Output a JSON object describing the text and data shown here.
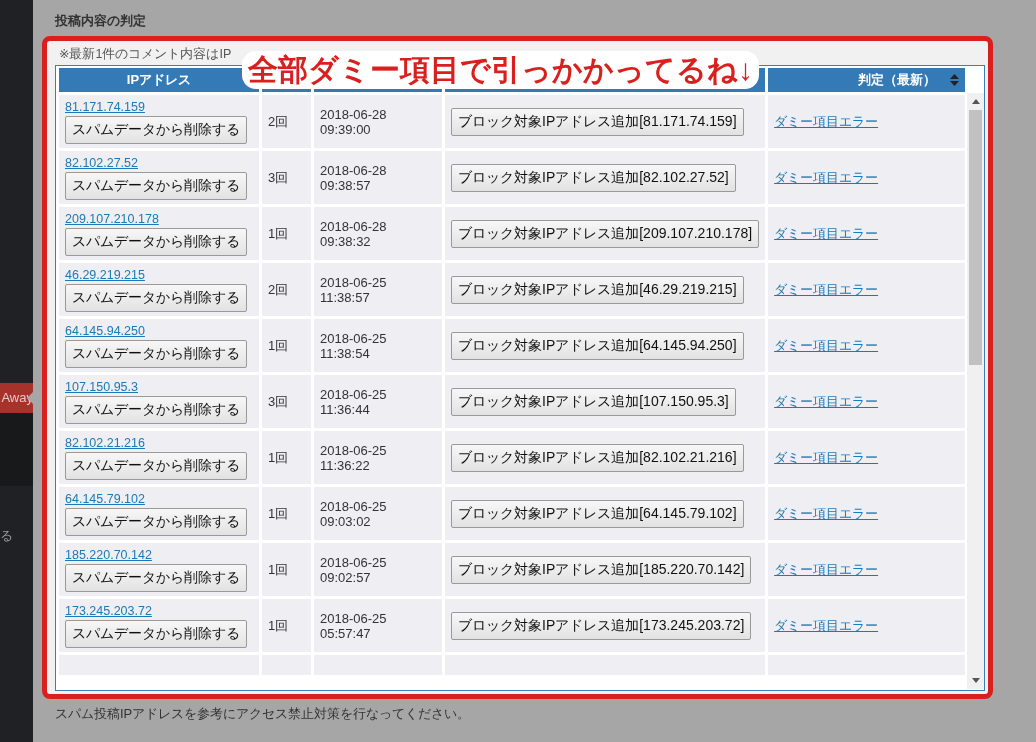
{
  "sidebar": {
    "badge": "Away",
    "fragment": "る"
  },
  "section_title": "投稿内容の判定",
  "note": "※最新1件のコメント内容はIP",
  "annotation": "全部ダミー項目で引っかかってるね↓",
  "table": {
    "columns": [
      {
        "label": "IPアドレス"
      },
      {
        "label": "判定（最新）"
      }
    ],
    "rows": [
      {
        "ip": "81.171.74.159",
        "delete": "スパムデータから削除する",
        "count": "2回",
        "date": "2018-06-28",
        "time": "09:39:00",
        "block": "ブロック対象IPアドレス追加[81.171.74.159]",
        "verdict": "ダミー項目エラー"
      },
      {
        "ip": "82.102.27.52",
        "delete": "スパムデータから削除する",
        "count": "3回",
        "date": "2018-06-28",
        "time": "09:38:57",
        "block": "ブロック対象IPアドレス追加[82.102.27.52]",
        "verdict": "ダミー項目エラー"
      },
      {
        "ip": "209.107.210.178",
        "delete": "スパムデータから削除する",
        "count": "1回",
        "date": "2018-06-28",
        "time": "09:38:32",
        "block": "ブロック対象IPアドレス追加[209.107.210.178]",
        "verdict": "ダミー項目エラー"
      },
      {
        "ip": "46.29.219.215",
        "delete": "スパムデータから削除する",
        "count": "2回",
        "date": "2018-06-25",
        "time": "11:38:57",
        "block": "ブロック対象IPアドレス追加[46.29.219.215]",
        "verdict": "ダミー項目エラー"
      },
      {
        "ip": "64.145.94.250",
        "delete": "スパムデータから削除する",
        "count": "1回",
        "date": "2018-06-25",
        "time": "11:38:54",
        "block": "ブロック対象IPアドレス追加[64.145.94.250]",
        "verdict": "ダミー項目エラー"
      },
      {
        "ip": "107.150.95.3",
        "delete": "スパムデータから削除する",
        "count": "3回",
        "date": "2018-06-25",
        "time": "11:36:44",
        "block": "ブロック対象IPアドレス追加[107.150.95.3]",
        "verdict": "ダミー項目エラー"
      },
      {
        "ip": "82.102.21.216",
        "delete": "スパムデータから削除する",
        "count": "1回",
        "date": "2018-06-25",
        "time": "11:36:22",
        "block": "ブロック対象IPアドレス追加[82.102.21.216]",
        "verdict": "ダミー項目エラー"
      },
      {
        "ip": "64.145.79.102",
        "delete": "スパムデータから削除する",
        "count": "1回",
        "date": "2018-06-25",
        "time": "09:03:02",
        "block": "ブロック対象IPアドレス追加[64.145.79.102]",
        "verdict": "ダミー項目エラー"
      },
      {
        "ip": "185.220.70.142",
        "delete": "スパムデータから削除する",
        "count": "1回",
        "date": "2018-06-25",
        "time": "09:02:57",
        "block": "ブロック対象IPアドレス追加[185.220.70.142]",
        "verdict": "ダミー項目エラー"
      },
      {
        "ip": "173.245.203.72",
        "delete": "スパムデータから削除する",
        "count": "1回",
        "date": "2018-06-25",
        "time": "05:57:47",
        "block": "ブロック対象IPアドレス追加[173.245.203.72]",
        "verdict": "ダミー項目エラー"
      }
    ]
  },
  "footer_note": "スパム投稿IPアドレスを参考にアクセス禁止対策を行なってください。"
}
